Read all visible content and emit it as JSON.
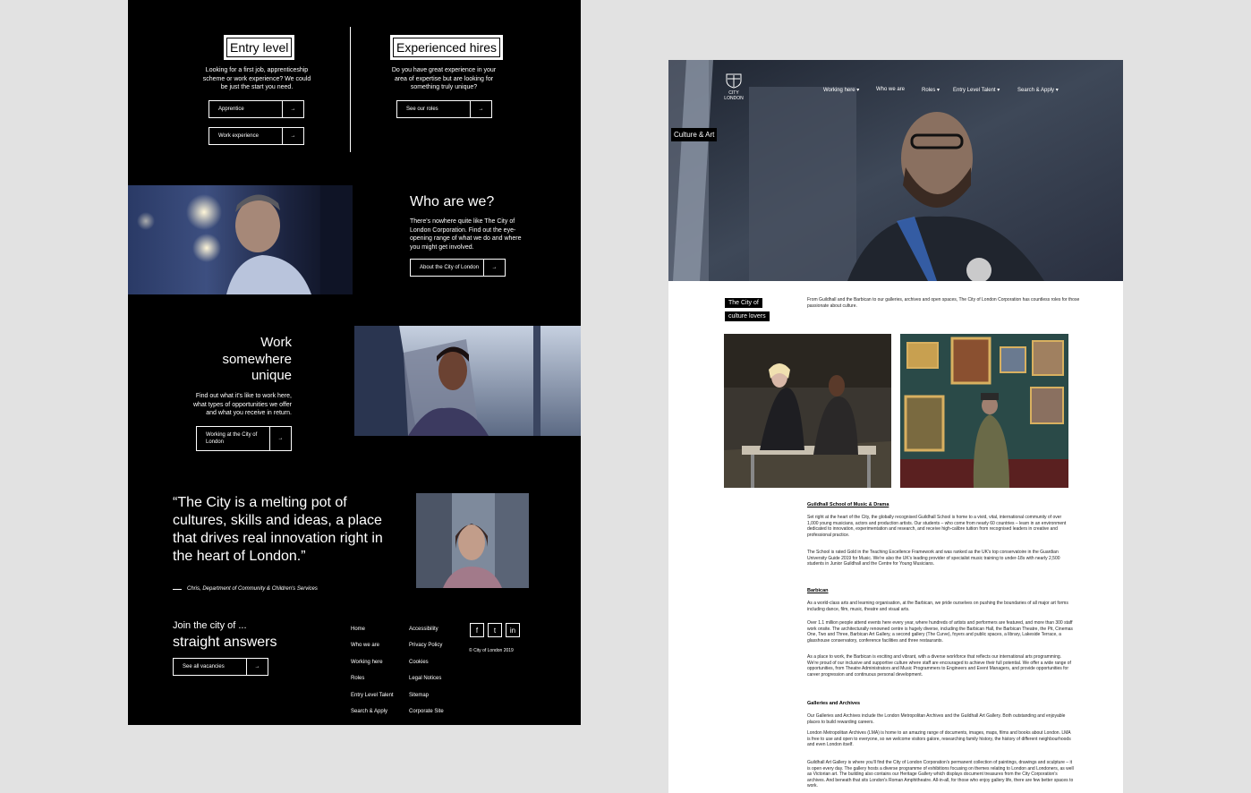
{
  "left": {
    "entry": {
      "title": "Entry level",
      "text": "Looking for a first job, apprenticeship scheme or work experience? We could be just the start you need.",
      "btn1": "Apprentice",
      "btn2": "Work experience"
    },
    "experienced": {
      "title": "Experienced hires",
      "text": "Do you have great experience in your area of expertise but are looking for something truly unique?",
      "btn": "See our roles"
    },
    "who": {
      "title": "Who are we?",
      "text": "There's nowhere quite like The City of London Corporation. Find out the eye-opening range of what we do and where you might get involved.",
      "btn": "About the City of London"
    },
    "work": {
      "title_l1": "Work",
      "title_l2": "somewhere",
      "title_l3": "unique",
      "text": "Find out what it's like to work here, what types of opportunities we offer and what you receive in return.",
      "btn": "Working at the City of London"
    },
    "quote": {
      "text": "“The City is a melting pot of cultures, skills and ideas, a place that drives real innovation right in the heart of London.”",
      "credit": "Chris, Department of Community & Children's Services"
    },
    "footer": {
      "join": "Join the city of ...",
      "answers": "straight answers",
      "btn": "See all vacancies",
      "col1": [
        "Home",
        "Who we are",
        "Working here",
        "Roles",
        "Entry Level Talent",
        "Search & Apply"
      ],
      "col2": [
        "Accessibility",
        "Privacy Policy",
        "Cookies",
        "Legal Notices",
        "Sitemap",
        "Corporate Site"
      ],
      "social": [
        "f",
        "t",
        "in"
      ],
      "copyright": "© City of London 2019"
    }
  },
  "right": {
    "logo_l1": "CITY",
    "logo_l2": "LONDON",
    "nav": [
      "Working here ▾",
      "Who we are",
      "Roles ▾",
      "Entry Level Talent ▾",
      "Search & Apply ▾"
    ],
    "hero_tag": "Culture & Art",
    "label1": "The City of",
    "label2": "culture lovers",
    "intro": "From Guildhall and the Barbican to our galleries, archives and open spaces, The City of London Corporation has countless roles for those passionate about culture.",
    "sections": [
      {
        "title": "Guildhall School of Music & Drama",
        "paras": [
          "Set right at the heart of the City, the globally recognised Guildhall School is home to a vivid, vital, international community of over 1,000 young musicians, actors and production artists. Our students – who come from nearly 60 countries – learn in an environment dedicated to innovation, experimentation and research, and receive high-calibre tuition from recognised leaders in creative and professional practice.",
          "The School is rated Gold in the Teaching Excellence Framework and was ranked as the UK's top conservatoire in the Guardian University Guide 2019 for Music. We're also the UK's leading provider of specialist music training to under-18s with nearly 2,500 students in Junior Guildhall and the Centre for Young Musicians."
        ]
      },
      {
        "title": "Barbican",
        "paras": [
          "As a world-class arts and learning organisation, at the Barbican, we pride ourselves on pushing the boundaries of all major art forms including dance, film, music, theatre and visual arts.",
          "Over 1.1 million people attend events here every year, where hundreds of artists and performers are featured, and more than 300 staff work onsite. The architecturally renowned centre is hugely diverse, including the Barbican Hall, the Barbican Theatre, the Pit, Cinemas One, Two and Three, Barbican Art Gallery, a second gallery (The Curve), foyers and public spaces, a library, Lakeside Terrace, a glasshouse conservatory, conference facilities and three restaurants.",
          "As a place to work, the Barbican is exciting and vibrant, with a diverse workforce that reflects our international arts programming. We're proud of our inclusive and supportive culture where staff are encouraged to achieve their full potential. We offer a wide range of opportunities, from Theatre Administrators and Music Programmers to Engineers and Event Managers, and provide opportunities for career progression and continuous personal development."
        ]
      },
      {
        "title": "Galleries and Archives",
        "paras": [
          "Our Galleries and Archives include the London Metropolitan Archives and the Guildhall Art Gallery. Both outstanding and enjoyable places to build rewarding careers.",
          "London Metropolitan Archives (LMA) is home to an amazing range of documents, images, maps, films and books about London. LMA is free to use and open to everyone, so we welcome visitors galore, researching family history, the history of different neighbourhoods and even London itself.",
          "Guildhall Art Gallery is where you'll find the City of London Corporation's permanent collection of paintings, drawings and sculpture – it is open every day. The gallery hosts a diverse programme of exhibitions focusing on themes relating to London and Londoners, as well as Victorian art. The building also contains our Heritage Gallery which displays document treasures from the City Corporation's archives. And beneath that sits London's Roman Amphitheatre. All-in-all, for those who enjoy gallery life, there are few better spaces to work."
        ]
      }
    ]
  }
}
